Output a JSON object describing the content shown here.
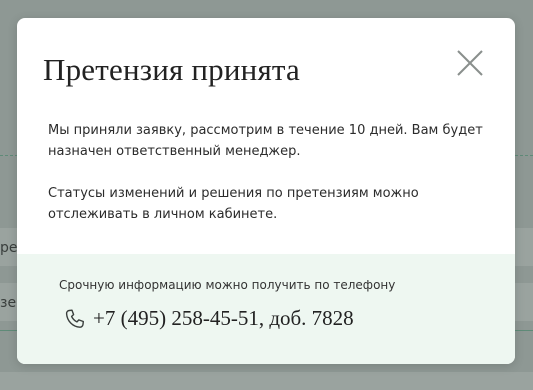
{
  "background": {
    "left_text_1": "ре",
    "left_text_2": "зе"
  },
  "modal": {
    "title": "Претензия принята",
    "close_icon": "close-x-icon",
    "paragraphs": [
      "Мы приняли заявку, рассмотрим в течение 10 дней. Вам будет назначен ответственный менеджер.",
      "Статусы изменений и решения по претензиям можно отслеживать в личном кабинете."
    ],
    "footer": {
      "note": "Срочную информацию можно получить по телефону",
      "phone_icon": "phone-icon",
      "phone": "+7 (495) 258-45-51, доб. 7828"
    }
  },
  "colors": {
    "overlay": "#8e9894",
    "footer_bg": "#eef7f1",
    "accent_green": "#5f8b78"
  }
}
